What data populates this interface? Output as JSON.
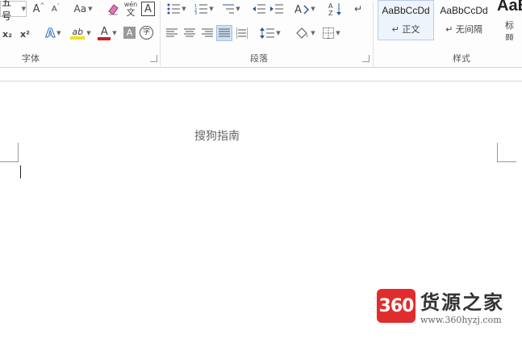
{
  "ribbon": {
    "font_size_value": "五号",
    "font_group_label": "字体",
    "paragraph_group_label": "段落",
    "styles_group_label": "样式",
    "font_buttons": {
      "grow": "A",
      "shrink": "A",
      "case": "Aa",
      "phonetic_top": "wén",
      "phonetic_bottom": "文",
      "char_border": "A",
      "subscript": "x₂",
      "superscript": "x²",
      "text_effects": "A",
      "highlight": "ab",
      "font_color": "A",
      "char_shading": "A",
      "enclose": "字"
    },
    "styles": [
      {
        "sample": "AaBbCcDd",
        "name": "↵ 正文"
      },
      {
        "sample": "AaBbCcDd",
        "name": "↵ 无间隔"
      },
      {
        "sample": "AaB",
        "name": "标题"
      }
    ],
    "colors": {
      "highlight": "#f0e020",
      "font_color": "#d02020",
      "accent": "#2b579a"
    }
  },
  "document": {
    "heading": "搜狗指南"
  },
  "watermark": {
    "badge": "360",
    "title": "货源之家",
    "url": "www.360hyzj.com"
  }
}
